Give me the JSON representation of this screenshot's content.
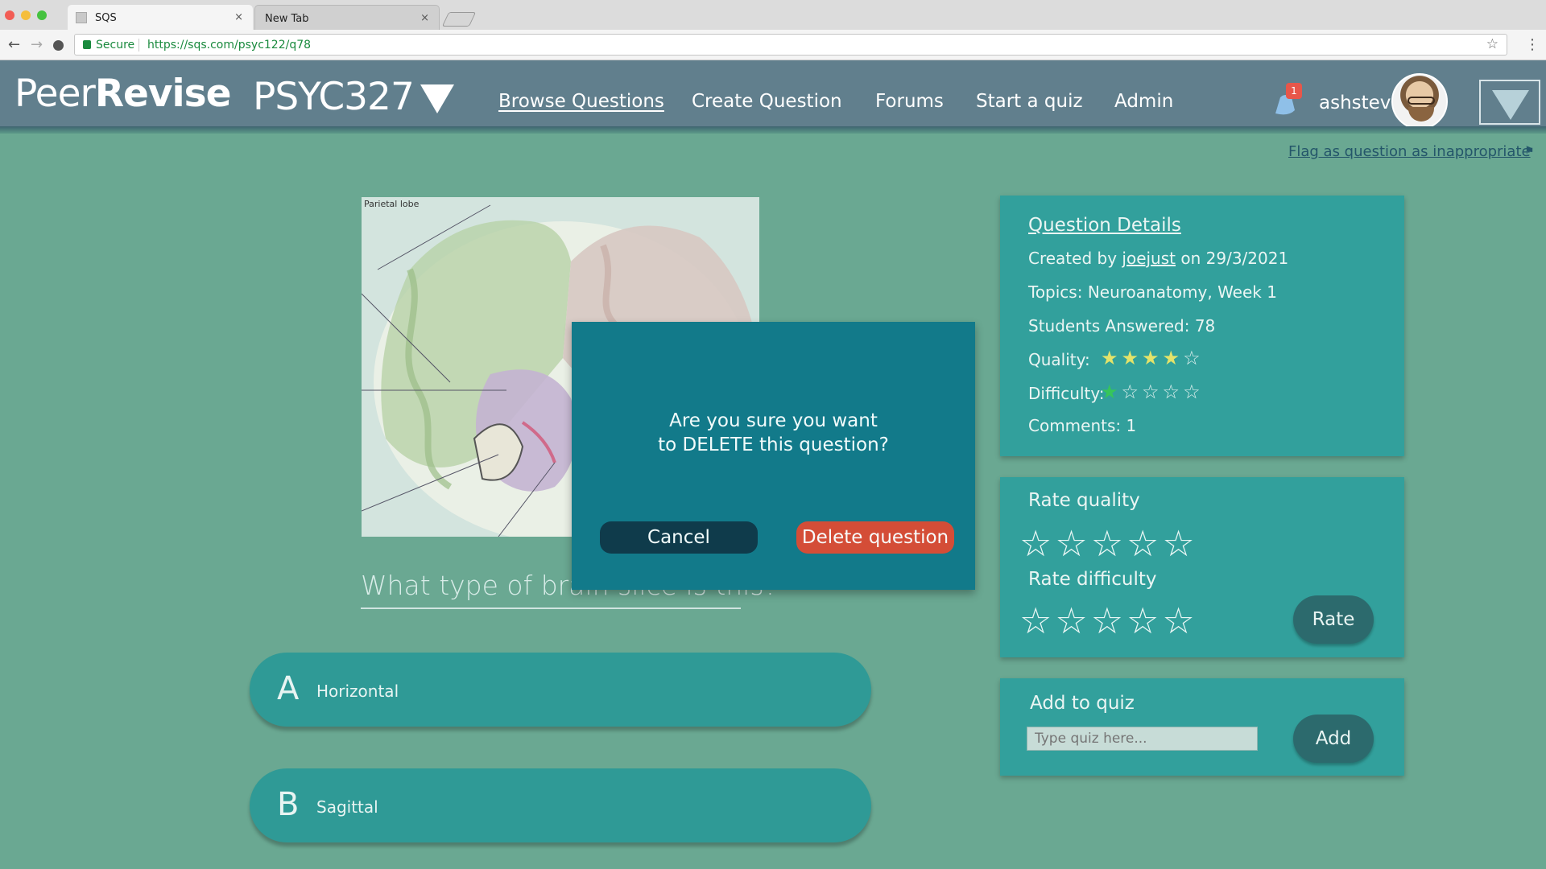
{
  "browser": {
    "tabs": [
      {
        "label": "SQS"
      },
      {
        "label": "New Tab"
      }
    ],
    "close_glyph": "×",
    "secure_label": "Secure",
    "url": "https://sqs.com/psyc122/q78"
  },
  "header": {
    "logo_light": "Peer",
    "logo_bold": "Revise",
    "course": "PSYC327",
    "nav": {
      "browse": "Browse Questions",
      "create": "Create Question",
      "forums": "Forums",
      "quiz": "Start a quiz",
      "admin": "Admin"
    },
    "notification_count": "1",
    "username": "ashstev"
  },
  "flag_link": "Flag as question as inappropriate",
  "question": {
    "image_caption": "Parietal lobe",
    "text": "What type of brain slice is this?",
    "answers": [
      {
        "letter": "A",
        "text": "Horizontal"
      },
      {
        "letter": "B",
        "text": "Sagittal"
      }
    ]
  },
  "details": {
    "title": "Question Details",
    "created_prefix": "Created by",
    "author": "joejust",
    "created_suffix": "on 29/3/2021",
    "topics": "Topics: Neuroanatomy, Week 1",
    "students_answered": "Students Answered: 78",
    "quality_label": "Quality:",
    "quality_rating": 4,
    "difficulty_label": "Difficulty:",
    "difficulty_rating": 1,
    "comments": "Comments: 1",
    "max_stars": 5
  },
  "rate": {
    "quality_label": "Rate quality",
    "difficulty_label": "Rate difficulty",
    "button": "Rate"
  },
  "add_quiz": {
    "title": "Add to quiz",
    "placeholder": "Type quiz here...",
    "button": "Add"
  },
  "modal": {
    "line1": "Are you sure you want",
    "line2": "to DELETE this question?",
    "cancel": "Cancel",
    "delete": "Delete question"
  },
  "colors": {
    "background": "#6aa892",
    "header": "#617f8d",
    "panel": "#32a09c",
    "modal": "#127a8a",
    "delete": "#d44d37"
  }
}
